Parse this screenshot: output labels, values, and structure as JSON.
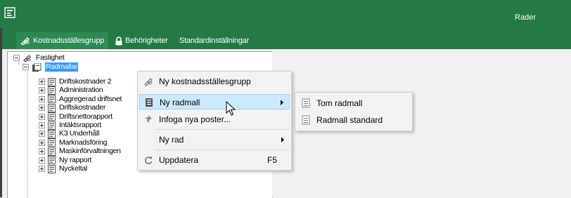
{
  "titlebar": {
    "right_label": "Rader",
    "icon": "table-window-icon"
  },
  "tabs": [
    {
      "label": "Kostnadsställesgrupp",
      "icon": "pencil-chain-icon",
      "active": true
    },
    {
      "label": "Behörigheter",
      "icon": "lock-icon",
      "active": false
    },
    {
      "label": "Standardinställningar",
      "icon": "",
      "active": false
    }
  ],
  "tree": {
    "root": {
      "label": "Fastighet",
      "icon": "pencil-chain-icon"
    },
    "folder": {
      "label": "Radmallar",
      "icon": "folder-doc-icon"
    },
    "items": [
      "Driftskostnader 2",
      "Administration",
      "Aggregerad driftsnet",
      "Driftskostnader",
      "Driftsnettorapport",
      "Intäktsrapport",
      "K3 Underhåll",
      "Marknadsföring",
      "Maskinförvaltningen",
      "Ny rapport",
      "Nyckeltal"
    ]
  },
  "context_menu": {
    "items": [
      {
        "label": "Ny kostnadsställesgrupp",
        "icon": "pencil-chain-icon",
        "shortcut": "",
        "submenu": false
      },
      {
        "label": "Ny radmall",
        "icon": "document-icon",
        "shortcut": "",
        "submenu": true,
        "highlighted": true
      },
      {
        "label": "Infoga nya poster...",
        "icon": "pin-icon",
        "shortcut": "",
        "submenu": false
      },
      {
        "label": "Ny rad",
        "icon": "",
        "shortcut": "",
        "submenu": true
      },
      {
        "label": "Uppdatera",
        "icon": "refresh-icon",
        "shortcut": "F5",
        "submenu": false
      }
    ]
  },
  "submenu": {
    "items": [
      {
        "label": "Tom radmall",
        "icon": "document-icon"
      },
      {
        "label": "Radmall standard",
        "icon": "document-icon"
      }
    ]
  },
  "colors": {
    "brand_green": "#237a45",
    "selection": "#3399ff",
    "menu_highlight": "#cce8ff"
  }
}
